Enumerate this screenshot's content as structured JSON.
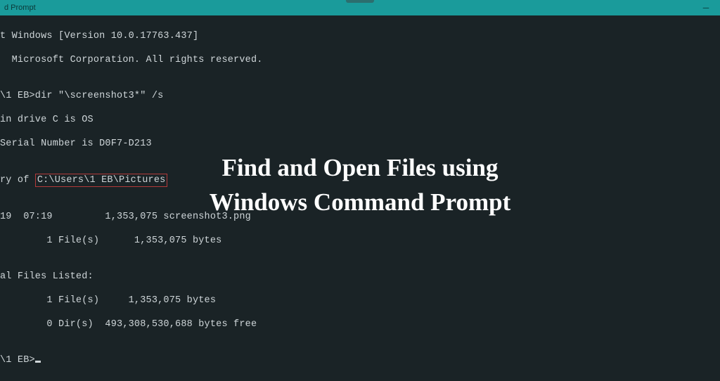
{
  "titlebar": {
    "title": "d Prompt"
  },
  "lines": {
    "l1": "t Windows [Version 10.0.17763.437]",
    "l2": "  Microsoft Corporation. All rights reserved.",
    "l3": "",
    "l4": "\\1 EB>dir \"\\screenshot3*\" /s",
    "l5": "in drive C is OS",
    "l6": "Serial Number is D0F7-D213",
    "l7": "",
    "l8_pre": "ry of ",
    "l8_box": "C:\\Users\\1 EB\\Pictures",
    "l9": "",
    "l10": "19  07:19         1,353,075 screenshot3.png",
    "l11": "        1 File(s)      1,353,075 bytes",
    "l12": "",
    "l13": "al Files Listed:",
    "l14": "        1 File(s)     1,353,075 bytes",
    "l15": "        0 Dir(s)  493,308,530,688 bytes free",
    "l16": "",
    "l17": "\\1 EB>"
  },
  "overlay": {
    "line1": "Find and Open Files using",
    "line2": "Windows Command Prompt"
  }
}
